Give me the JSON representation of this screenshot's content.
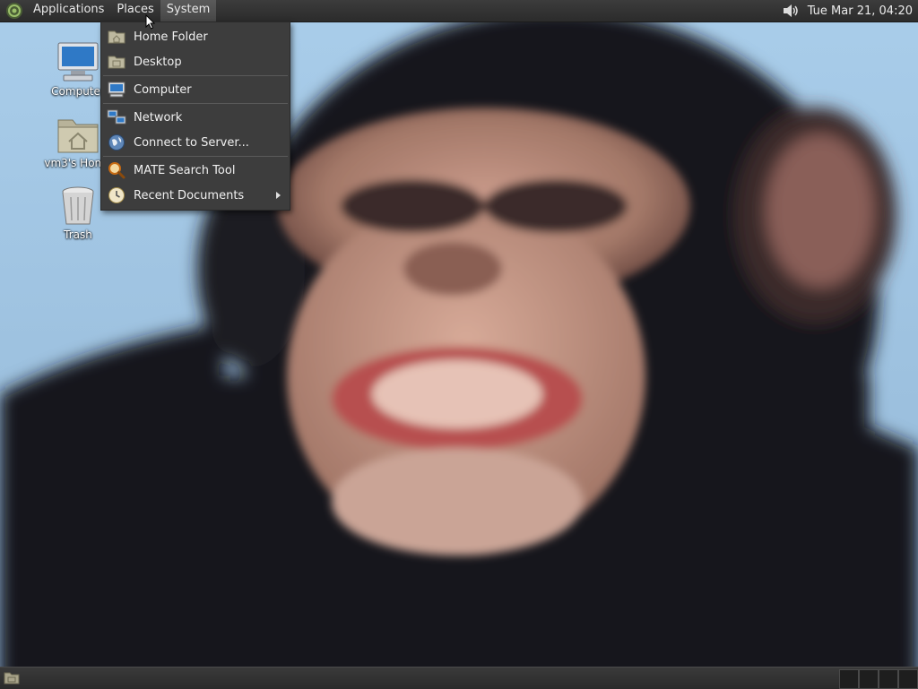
{
  "top_panel": {
    "menus": [
      "Applications",
      "Places",
      "System"
    ],
    "clock": "Tue Mar 21, 04:20"
  },
  "places_menu": {
    "items": [
      {
        "label": "Home Folder",
        "icon": "home-folder-icon"
      },
      {
        "label": "Desktop",
        "icon": "desktop-folder-icon"
      },
      {
        "label": "Computer",
        "icon": "computer-icon"
      },
      {
        "label": "Network",
        "icon": "network-icon"
      },
      {
        "label": "Connect to Server...",
        "icon": "globe-icon"
      },
      {
        "label": "MATE Search Tool",
        "icon": "magnifier-icon"
      },
      {
        "label": "Recent Documents",
        "icon": "recent-clock-icon",
        "has_submenu": true
      }
    ]
  },
  "desktop_icons": [
    {
      "label": "Computer",
      "icon": "computer-icon"
    },
    {
      "label": "vm3's Home",
      "icon": "home-folder-icon"
    },
    {
      "label": "Trash",
      "icon": "trash-icon"
    }
  ],
  "wallpaper": {
    "subject": "chimpanzee-face",
    "sky_color": "#a9cdea",
    "fur_color": "#14141c",
    "face_color": "#b58a7a"
  }
}
